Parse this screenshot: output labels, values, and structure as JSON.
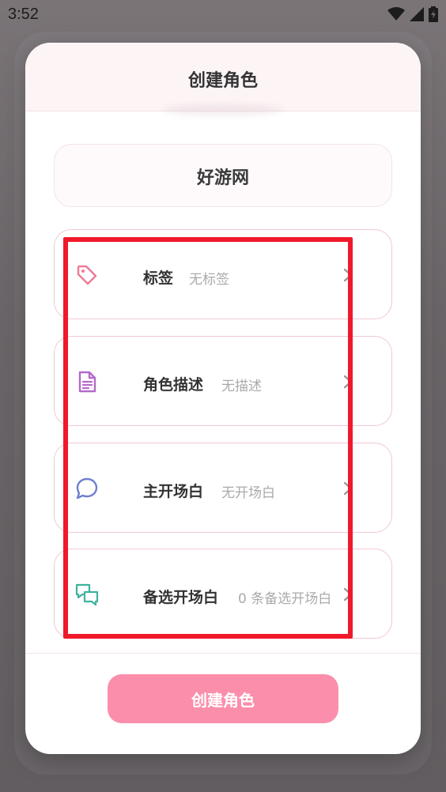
{
  "status_bar": {
    "time": "3:52"
  },
  "dialog": {
    "title": "创建角色",
    "name": "好游网",
    "rows": [
      {
        "label": "标签",
        "value": "无标签",
        "icon": "tag-icon",
        "icon_color": "#f07a96"
      },
      {
        "label": "角色描述",
        "value": "无描述",
        "icon": "document-icon",
        "icon_color": "#b36ac9"
      },
      {
        "label": "主开场白",
        "value": "无开场白",
        "icon": "chat-bubble-icon",
        "icon_color": "#6f7fd0"
      },
      {
        "label": "备选开场白",
        "value": "0 条备选开场白",
        "icon": "chat-bubbles-icon",
        "icon_color": "#3fb2a0"
      }
    ],
    "create_button": "创建角色"
  },
  "colors": {
    "accent": "#fb8fab",
    "highlight_box": "#f0192a"
  }
}
